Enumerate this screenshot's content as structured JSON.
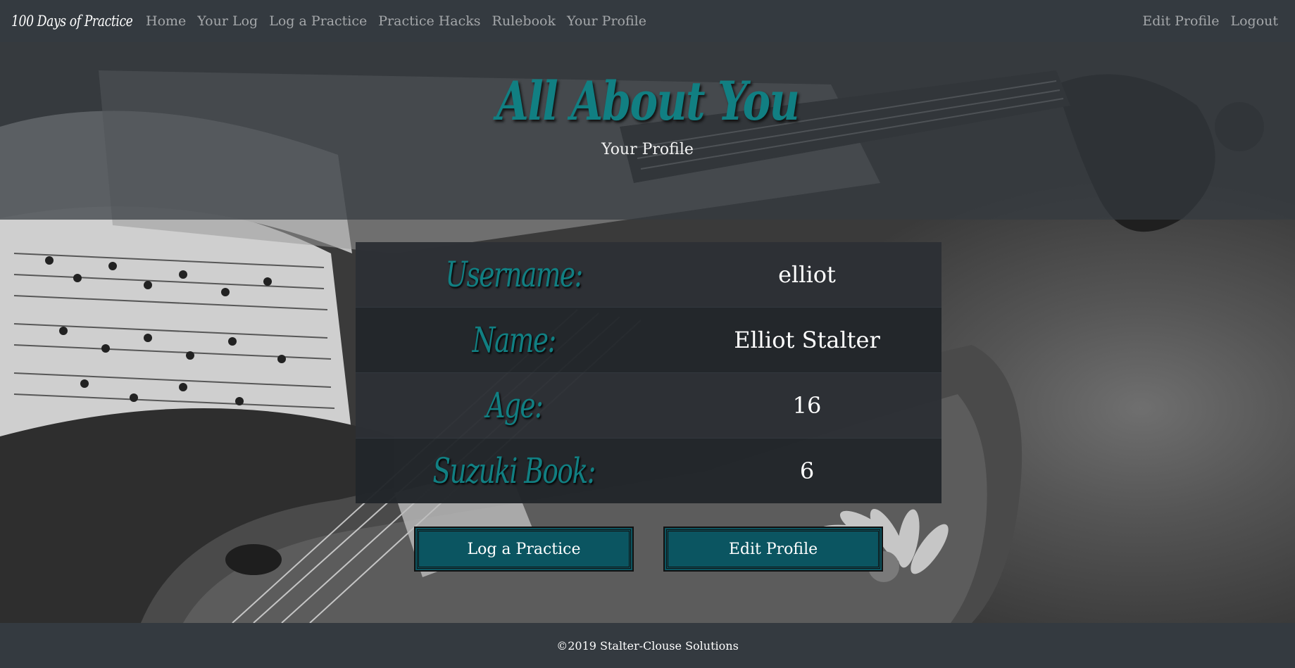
{
  "navbar": {
    "brand": "100 Days of Practice",
    "links": [
      "Home",
      "Your Log",
      "Log a Practice",
      "Practice Hacks",
      "Rulebook",
      "Your Profile"
    ],
    "right_links": [
      "Edit Profile",
      "Logout"
    ]
  },
  "hero": {
    "title": "All About You",
    "subtitle": "Your Profile"
  },
  "profile": {
    "rows": [
      {
        "label": "Username:",
        "value": "elliot"
      },
      {
        "label": "Name:",
        "value": "Elliot Stalter"
      },
      {
        "label": "Age:",
        "value": "16"
      },
      {
        "label": "Suzuki Book:",
        "value": "6"
      }
    ]
  },
  "actions": {
    "log_practice": "Log a Practice",
    "edit_profile": "Edit Profile"
  },
  "footer": {
    "text": "©2019 Stalter-Clouse Solutions"
  },
  "colors": {
    "accent": "#117f82",
    "button": "#0b5561",
    "navbar": "#343a40"
  }
}
